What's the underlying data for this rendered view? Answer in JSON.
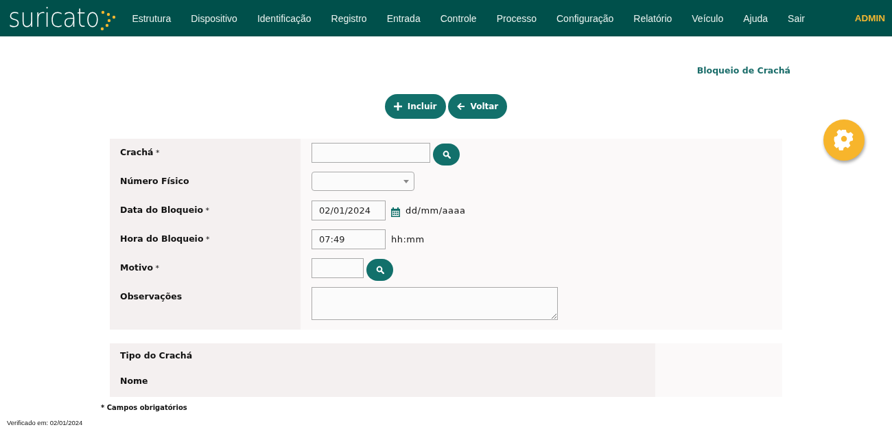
{
  "header": {
    "logo": "suricato",
    "menu": [
      "Estrutura",
      "Dispositivo",
      "Identificação",
      "Registro",
      "Entrada",
      "Controle",
      "Processo",
      "Configuração",
      "Relatório",
      "Veículo",
      "Ajuda",
      "Sair"
    ],
    "user": "ADMIN"
  },
  "page_title": "Bloqueio de Crachá",
  "actions": [
    {
      "label": "Incluir",
      "kind": "add"
    },
    {
      "label": "Voltar",
      "kind": "back"
    }
  ],
  "form": {
    "fields": [
      {
        "label": "Crachá",
        "required_mark": "*",
        "kind": "lookup"
      },
      {
        "label": "Número Físico",
        "kind": "select"
      },
      {
        "label": "Data do Bloqueio",
        "required_mark": "*",
        "kind": "date",
        "value": "02/01/2024",
        "hint": "dd/mm/aaaa"
      },
      {
        "label": "Hora do Bloqueio",
        "required_mark": "*",
        "kind": "time",
        "value": "07:49",
        "hint": "hh:mm"
      },
      {
        "label": "Motivo",
        "required_mark": "*",
        "kind": "lookup-short"
      },
      {
        "label": "Observações",
        "kind": "textarea"
      }
    ]
  },
  "info": [
    "Tipo do Crachá",
    "Nome"
  ],
  "footnote": "* Campos obrigatórios",
  "verified": "Verificado em: 02/01/2024"
}
